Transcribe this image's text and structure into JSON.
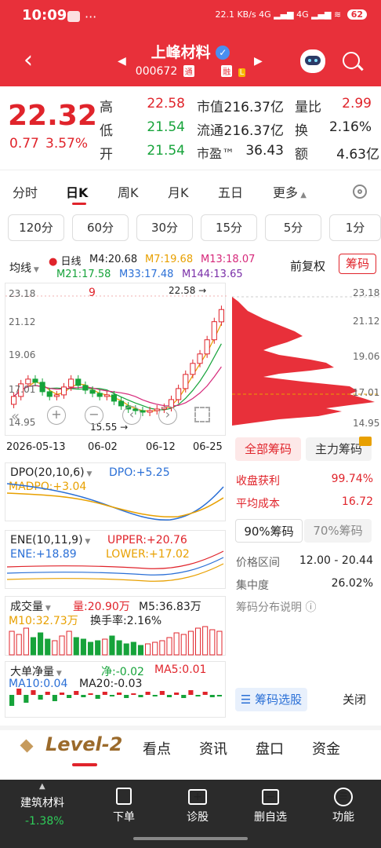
{
  "status": {
    "time": "10:09",
    "net": "22.1 KB/s",
    "battery": "62"
  },
  "header": {
    "name": "上峰材料",
    "code": "000672",
    "tag1": "通",
    "tag2": "融",
    "tag3": "L"
  },
  "quote": {
    "price": "22.32",
    "change": "0.77",
    "change_pct": "3.57%",
    "high_label": "高",
    "high": "22.58",
    "low_label": "低",
    "low": "21.54",
    "open_label": "开",
    "open": "21.54",
    "mcap_label": "市值",
    "mcap": "216.37亿",
    "float_label": "流通",
    "float": "216.37亿",
    "pe_label": "市盈™",
    "pe": "36.43",
    "vr_label": "量比",
    "vr": "2.99",
    "turn_label": "换",
    "turn": "2.16%",
    "amt_label": "额",
    "amt": "4.63亿"
  },
  "tabs": {
    "t1": "分时",
    "t2": "日K",
    "t3": "周K",
    "t4": "月K",
    "t5": "五日",
    "t6": "更多"
  },
  "intervals": {
    "i1": "120分",
    "i2": "60分",
    "i3": "30分",
    "i4": "15分",
    "i5": "5分",
    "i6": "1分"
  },
  "ma": {
    "type": "均线",
    "line": "日线",
    "m4": "M4:20.68",
    "m7": "M7:19.68",
    "m13": "M13:18.07",
    "m21": "M21:17.58",
    "m33": "M33:17.48",
    "m144": "M144:13.65",
    "fq": "前复权",
    "chip_btn": "筹码"
  },
  "chart_axis": {
    "y1": "23.18",
    "y2": "21.12",
    "y3": "19.06",
    "y4": "17.01",
    "y5": "14.95",
    "d1": "2026-05-13",
    "d2": "06-02",
    "d3": "06-12",
    "d4": "06-25",
    "max_label": "22.58",
    "min_label": "15.55",
    "flag_red": "9"
  },
  "chart_data": {
    "type": "candlestick",
    "x": [
      "2026-05-13",
      "",
      "",
      "",
      "",
      "",
      "",
      "",
      "",
      "",
      "",
      "",
      "",
      "",
      "06-02",
      "",
      "",
      "",
      "",
      "",
      "",
      "",
      "06-12",
      "",
      "",
      "",
      "",
      "",
      "",
      "06-25"
    ],
    "open": [
      16.3,
      16.8,
      17.6,
      17.9,
      17.7,
      17.1,
      16.8,
      16.9,
      17.4,
      17.9,
      17.5,
      17.2,
      17.0,
      16.8,
      16.9,
      16.5,
      16.2,
      16.0,
      15.9,
      15.8,
      15.9,
      16.0,
      16.1,
      16.6,
      17.3,
      18.2,
      18.9,
      19.5,
      20.4,
      21.54
    ],
    "close": [
      16.8,
      17.6,
      17.9,
      17.7,
      17.1,
      16.8,
      16.9,
      17.4,
      17.9,
      17.5,
      17.2,
      17.0,
      16.8,
      16.9,
      16.5,
      16.2,
      16.0,
      15.9,
      15.8,
      15.9,
      16.0,
      16.1,
      16.6,
      17.3,
      18.2,
      18.9,
      19.5,
      20.4,
      21.55,
      22.32
    ],
    "ylim": [
      14.95,
      23.18
    ]
  },
  "dpo": {
    "title": "DPO(20,10,6)",
    "dpo": "DPO:+5.25",
    "madpo": "MADPO:+3.04"
  },
  "ene": {
    "title": "ENE(10,11,9)",
    "upper": "UPPER:+20.76",
    "ene": "ENE:+18.89",
    "lower": "LOWER:+17.02"
  },
  "vol": {
    "title": "成交量",
    "vol": "量:20.90万",
    "m5": "M5:36.83万",
    "m10": "M10:32.73万",
    "turn": "换手率:2.16%"
  },
  "dadan": {
    "title": "大单净量",
    "net": "净:-0.02",
    "ma5": "MA5:0.01",
    "ma10": "MA10:0.04",
    "ma20": "MA20:-0.03"
  },
  "chips": {
    "tab_all": "全部筹码",
    "tab_main": "主力筹码",
    "profit_label": "收盘获利",
    "profit": "99.74%",
    "cost_label": "平均成本",
    "cost": "16.72",
    "c90": "90%筹码",
    "c70": "70%筹码",
    "range_label": "价格区间",
    "range": "12.00 - 20.44",
    "conc_label": "集中度",
    "conc": "26.02%",
    "help": "筹码分布说明",
    "select_btn": "筹码选股",
    "close_btn": "关闭",
    "y1": "23.18",
    "y2": "21.12",
    "y3": "19.06",
    "y4": "17.01",
    "y5": "14.95"
  },
  "bottom_tabs": {
    "level2": "Level-2",
    "b1": "看点",
    "b2": "资讯",
    "b3": "盘口",
    "b4": "资金"
  },
  "bottom_bar": {
    "sector": "建筑材料",
    "sector_chg": "-1.38%",
    "a1": "下单",
    "a2": "诊股",
    "a3": "删自选",
    "a4": "功能"
  },
  "colors": {
    "up": "#e0242b",
    "down": "#16a33a",
    "header": "#e8303a"
  }
}
